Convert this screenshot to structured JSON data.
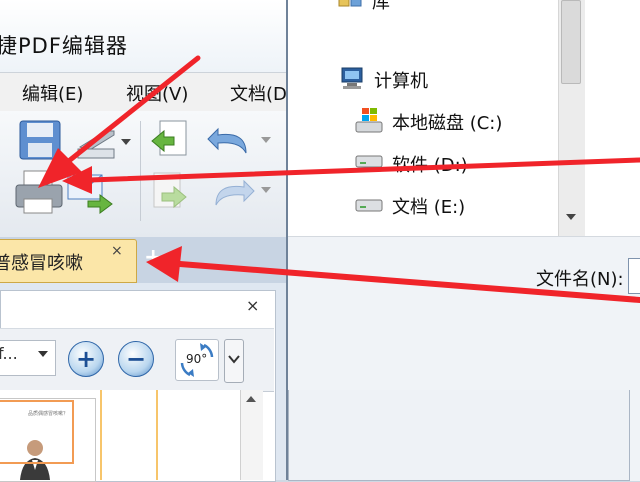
{
  "app": {
    "title": "捷PDF编辑器",
    "menu": [
      {
        "label": "编辑(E)"
      },
      {
        "label": "视图(V)"
      },
      {
        "label": "文档(D"
      }
    ],
    "tab": {
      "label": "普感冒咳嗽",
      "close": "×",
      "new_tab": "+"
    },
    "panel": {
      "close": "×",
      "zoom_text": "f...",
      "zoom_in": "+",
      "zoom_out": "−",
      "rotate_label": "90°"
    },
    "thumbnail": {
      "heading": "品质偶感冒咳嗽？"
    }
  },
  "dialog": {
    "tree": [
      {
        "label": "库",
        "icon": "library-icon"
      },
      {
        "label": "计算机",
        "icon": "computer-icon"
      },
      {
        "label": "本地磁盘 (C:)",
        "icon": "windows-drive-icon"
      },
      {
        "label": "软件 (D:)",
        "icon": "drive-icon"
      },
      {
        "label": "文档 (E:)",
        "icon": "drive-icon"
      }
    ],
    "filename_label": "文件名(N):"
  },
  "colors": {
    "arrow": "#f0242a",
    "tab_active": "#fbe6a8",
    "accent_blue": "#2f66a8"
  }
}
